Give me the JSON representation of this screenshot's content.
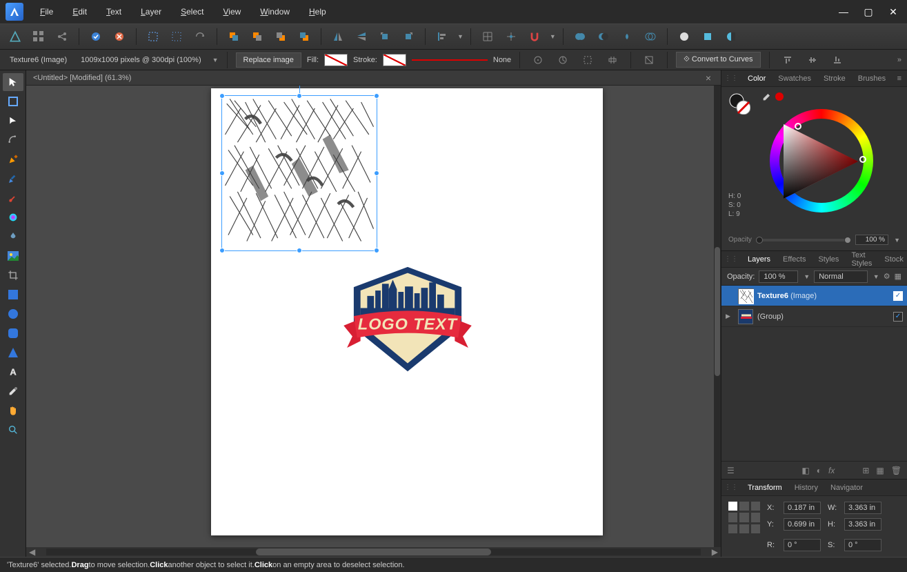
{
  "menu": {
    "file": "File",
    "edit": "Edit",
    "text": "Text",
    "layer": "Layer",
    "select": "Select",
    "view": "View",
    "window": "Window",
    "help": "Help"
  },
  "context": {
    "object_label": "Texture6 (Image)",
    "doc_info": "1009x1009 pixels @ 300dpi (100%)",
    "replace_btn": "Replace image",
    "fill_label": "Fill:",
    "stroke_label": "Stroke:",
    "none_label": "None",
    "convert_btn": "Convert to Curves"
  },
  "doc_tab": "<Untitled> [Modified] (61.3%)",
  "logo_text": "LOGO TEXT",
  "panels": {
    "color_tabs": {
      "color": "Color",
      "swatches": "Swatches",
      "stroke": "Stroke",
      "brushes": "Brushes"
    },
    "hsl": {
      "h": "H: 0",
      "s": "S: 0",
      "l": "L: 9"
    },
    "opacity_label": "Opacity",
    "opacity_value": "100 %",
    "layers_tabs": {
      "layers": "Layers",
      "effects": "Effects",
      "styles": "Styles",
      "text_styles": "Text Styles",
      "stock": "Stock"
    },
    "layer_opacity_label": "Opacity:",
    "layer_opacity_value": "100 %",
    "blend_mode": "Normal",
    "layers": [
      {
        "name": "Texture6",
        "suffix": "(Image)",
        "selected": true
      },
      {
        "name": "(Group)",
        "suffix": "",
        "selected": false
      }
    ],
    "transform_tabs": {
      "transform": "Transform",
      "history": "History",
      "navigator": "Navigator"
    },
    "tf": {
      "x_label": "X:",
      "x": "0.187 in",
      "y_label": "Y:",
      "y": "0.699 in",
      "w_label": "W:",
      "w": "3.363 in",
      "h_label": "H:",
      "h": "3.363 in",
      "r_label": "R:",
      "r": "0 °",
      "s_label": "S:",
      "s": "0 °"
    }
  },
  "status": {
    "p1": "'Texture6' selected. ",
    "b1": "Drag",
    "p2": " to move selection. ",
    "b2": "Click",
    "p3": " another object to select it. ",
    "b3": "Click",
    "p4": " on an empty area to deselect selection."
  }
}
